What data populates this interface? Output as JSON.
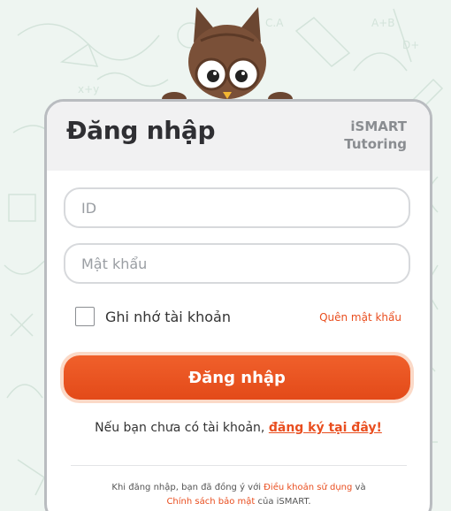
{
  "brand": {
    "line1": "iSMART",
    "line2": "Tutoring"
  },
  "login": {
    "title": "Đăng nhập",
    "id_placeholder": "ID",
    "password_placeholder": "Mật khẩu",
    "remember_label": "Ghi nhớ tài khoản",
    "forgot_link": "Quên mật khẩu",
    "submit_label": "Đăng nhập"
  },
  "signup": {
    "prompt": "Nếu bạn chưa có tài khoản, ",
    "link": "đăng ký tại đây!"
  },
  "terms": {
    "prefix": "Khi đăng nhập, bạn đã đồng ý với ",
    "terms_link": "Điều khoản sử dụng",
    "middle": " và ",
    "privacy_link": "Chính sách bảo mật",
    "suffix": " của iSMART."
  },
  "colors": {
    "accent": "#e94e1f",
    "background": "#eef5f1",
    "owl_body": "#6b4631"
  },
  "icons": {
    "mascot": "owl-mascot"
  },
  "remember_checked": false
}
